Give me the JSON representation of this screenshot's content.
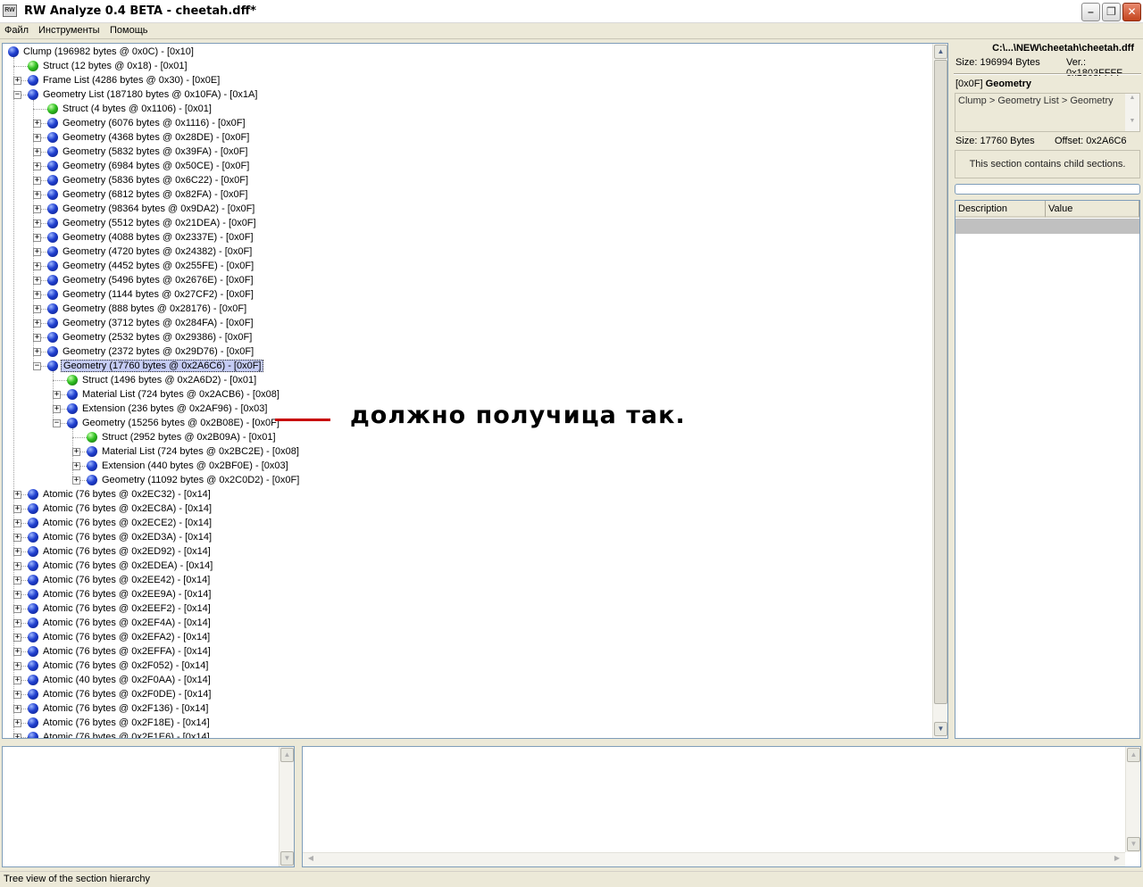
{
  "window": {
    "title": "RW Analyze 0.4 BETA - cheetah.dff*",
    "icon": "app-icon",
    "icon_text": "RW"
  },
  "menu": [
    "Файл",
    "Инструменты",
    "Помощь"
  ],
  "tree": [
    {
      "label": "Clump  (196982 bytes @ 0x0C) - [0x10]",
      "level": 0,
      "icon": "blue",
      "expander": "none"
    },
    {
      "label": "Struct  (12 bytes @ 0x18) - [0x01]",
      "level": 1,
      "icon": "green",
      "expander": "none"
    },
    {
      "label": "Frame List  (4286 bytes @ 0x30) - [0x0E]",
      "level": 1,
      "icon": "blue",
      "expander": "plus"
    },
    {
      "label": "Geometry List  (187180 bytes @ 0x10FA) - [0x1A]",
      "level": 1,
      "icon": "blue",
      "expander": "minus"
    },
    {
      "label": "Struct  (4 bytes @ 0x1106) - [0x01]",
      "level": 2,
      "icon": "green",
      "expander": "none"
    },
    {
      "label": "Geometry  (6076 bytes @ 0x1116) - [0x0F]",
      "level": 2,
      "icon": "blue",
      "expander": "plus"
    },
    {
      "label": "Geometry  (4368 bytes @ 0x28DE) - [0x0F]",
      "level": 2,
      "icon": "blue",
      "expander": "plus"
    },
    {
      "label": "Geometry  (5832 bytes @ 0x39FA) - [0x0F]",
      "level": 2,
      "icon": "blue",
      "expander": "plus"
    },
    {
      "label": "Geometry  (6984 bytes @ 0x50CE) - [0x0F]",
      "level": 2,
      "icon": "blue",
      "expander": "plus"
    },
    {
      "label": "Geometry  (5836 bytes @ 0x6C22) - [0x0F]",
      "level": 2,
      "icon": "blue",
      "expander": "plus"
    },
    {
      "label": "Geometry  (6812 bytes @ 0x82FA) - [0x0F]",
      "level": 2,
      "icon": "blue",
      "expander": "plus"
    },
    {
      "label": "Geometry  (98364 bytes @ 0x9DA2) - [0x0F]",
      "level": 2,
      "icon": "blue",
      "expander": "plus"
    },
    {
      "label": "Geometry  (5512 bytes @ 0x21DEA) - [0x0F]",
      "level": 2,
      "icon": "blue",
      "expander": "plus"
    },
    {
      "label": "Geometry  (4088 bytes @ 0x2337E) - [0x0F]",
      "level": 2,
      "icon": "blue",
      "expander": "plus"
    },
    {
      "label": "Geometry  (4720 bytes @ 0x24382) - [0x0F]",
      "level": 2,
      "icon": "blue",
      "expander": "plus"
    },
    {
      "label": "Geometry  (4452 bytes @ 0x255FE) - [0x0F]",
      "level": 2,
      "icon": "blue",
      "expander": "plus"
    },
    {
      "label": "Geometry  (5496 bytes @ 0x2676E) - [0x0F]",
      "level": 2,
      "icon": "blue",
      "expander": "plus"
    },
    {
      "label": "Geometry  (1144 bytes @ 0x27CF2) - [0x0F]",
      "level": 2,
      "icon": "blue",
      "expander": "plus"
    },
    {
      "label": "Geometry  (888 bytes @ 0x28176) - [0x0F]",
      "level": 2,
      "icon": "blue",
      "expander": "plus"
    },
    {
      "label": "Geometry  (3712 bytes @ 0x284FA) - [0x0F]",
      "level": 2,
      "icon": "blue",
      "expander": "plus"
    },
    {
      "label": "Geometry  (2532 bytes @ 0x29386) - [0x0F]",
      "level": 2,
      "icon": "blue",
      "expander": "plus"
    },
    {
      "label": "Geometry  (2372 bytes @ 0x29D76) - [0x0F]",
      "level": 2,
      "icon": "blue",
      "expander": "plus"
    },
    {
      "label": "Geometry  (17760 bytes @ 0x2A6C6) - [0x0F]",
      "level": 2,
      "icon": "blue",
      "expander": "minus",
      "selected": true
    },
    {
      "label": "Struct  (1496 bytes @ 0x2A6D2) - [0x01]",
      "level": 3,
      "icon": "green",
      "expander": "none"
    },
    {
      "label": "Material List  (724 bytes @ 0x2ACB6) - [0x08]",
      "level": 3,
      "icon": "blue",
      "expander": "plus"
    },
    {
      "label": "Extension  (236 bytes @ 0x2AF96) - [0x03]",
      "level": 3,
      "icon": "blue",
      "expander": "plus"
    },
    {
      "label": "Geometry  (15256 bytes @ 0x2B08E) - [0x0F]",
      "level": 3,
      "icon": "blue",
      "expander": "minus"
    },
    {
      "label": "Struct  (2952 bytes @ 0x2B09A) - [0x01]",
      "level": 4,
      "icon": "green",
      "expander": "none"
    },
    {
      "label": "Material List  (724 bytes @ 0x2BC2E) - [0x08]",
      "level": 4,
      "icon": "blue",
      "expander": "plus"
    },
    {
      "label": "Extension  (440 bytes @ 0x2BF0E) - [0x03]",
      "level": 4,
      "icon": "blue",
      "expander": "plus"
    },
    {
      "label": "Geometry  (11092 bytes @ 0x2C0D2) - [0x0F]",
      "level": 4,
      "icon": "blue",
      "expander": "plus"
    },
    {
      "label": "Atomic  (76 bytes @ 0x2EC32) - [0x14]",
      "level": 1,
      "icon": "blue",
      "expander": "plus"
    },
    {
      "label": "Atomic  (76 bytes @ 0x2EC8A) - [0x14]",
      "level": 1,
      "icon": "blue",
      "expander": "plus"
    },
    {
      "label": "Atomic  (76 bytes @ 0x2ECE2) - [0x14]",
      "level": 1,
      "icon": "blue",
      "expander": "plus"
    },
    {
      "label": "Atomic  (76 bytes @ 0x2ED3A) - [0x14]",
      "level": 1,
      "icon": "blue",
      "expander": "plus"
    },
    {
      "label": "Atomic  (76 bytes @ 0x2ED92) - [0x14]",
      "level": 1,
      "icon": "blue",
      "expander": "plus"
    },
    {
      "label": "Atomic  (76 bytes @ 0x2EDEA) - [0x14]",
      "level": 1,
      "icon": "blue",
      "expander": "plus"
    },
    {
      "label": "Atomic  (76 bytes @ 0x2EE42) - [0x14]",
      "level": 1,
      "icon": "blue",
      "expander": "plus"
    },
    {
      "label": "Atomic  (76 bytes @ 0x2EE9A) - [0x14]",
      "level": 1,
      "icon": "blue",
      "expander": "plus"
    },
    {
      "label": "Atomic  (76 bytes @ 0x2EEF2) - [0x14]",
      "level": 1,
      "icon": "blue",
      "expander": "plus"
    },
    {
      "label": "Atomic  (76 bytes @ 0x2EF4A) - [0x14]",
      "level": 1,
      "icon": "blue",
      "expander": "plus"
    },
    {
      "label": "Atomic  (76 bytes @ 0x2EFA2) - [0x14]",
      "level": 1,
      "icon": "blue",
      "expander": "plus"
    },
    {
      "label": "Atomic  (76 bytes @ 0x2EFFA) - [0x14]",
      "level": 1,
      "icon": "blue",
      "expander": "plus"
    },
    {
      "label": "Atomic  (76 bytes @ 0x2F052) - [0x14]",
      "level": 1,
      "icon": "blue",
      "expander": "plus"
    },
    {
      "label": "Atomic  (40 bytes @ 0x2F0AA) - [0x14]",
      "level": 1,
      "icon": "blue",
      "expander": "plus"
    },
    {
      "label": "Atomic  (76 bytes @ 0x2F0DE) - [0x14]",
      "level": 1,
      "icon": "blue",
      "expander": "plus"
    },
    {
      "label": "Atomic  (76 bytes @ 0x2F136) - [0x14]",
      "level": 1,
      "icon": "blue",
      "expander": "plus"
    },
    {
      "label": "Atomic  (76 bytes @ 0x2F18E) - [0x14]",
      "level": 1,
      "icon": "blue",
      "expander": "plus"
    },
    {
      "label": "Atomic  (76 bytes @ 0x2F1E6) - [0x14]",
      "level": 1,
      "icon": "blue",
      "expander": "plus"
    }
  ],
  "annotation": {
    "text": "должно получица так.",
    "line_color": "#c80000"
  },
  "details": {
    "path": "C:\\...\\NEW\\cheetah\\cheetah.dff",
    "size": "Size: 196994 Bytes",
    "version": "Ver.: 0x1803FFFF",
    "section_id": "[0x0F]",
    "section_name": "Geometry",
    "breadcrumb": "Clump > Geometry List > Geometry",
    "section_size": "Size: 17760 Bytes",
    "section_offset": "Offset: 0x2A6C6",
    "note": "This section contains child sections.",
    "columns": [
      "Description",
      "Value"
    ]
  },
  "status": "Tree view of the section hierarchy",
  "colors": {
    "selection": "#c5ccf5",
    "node_blue": "#2040d0",
    "node_green": "#30c020"
  }
}
